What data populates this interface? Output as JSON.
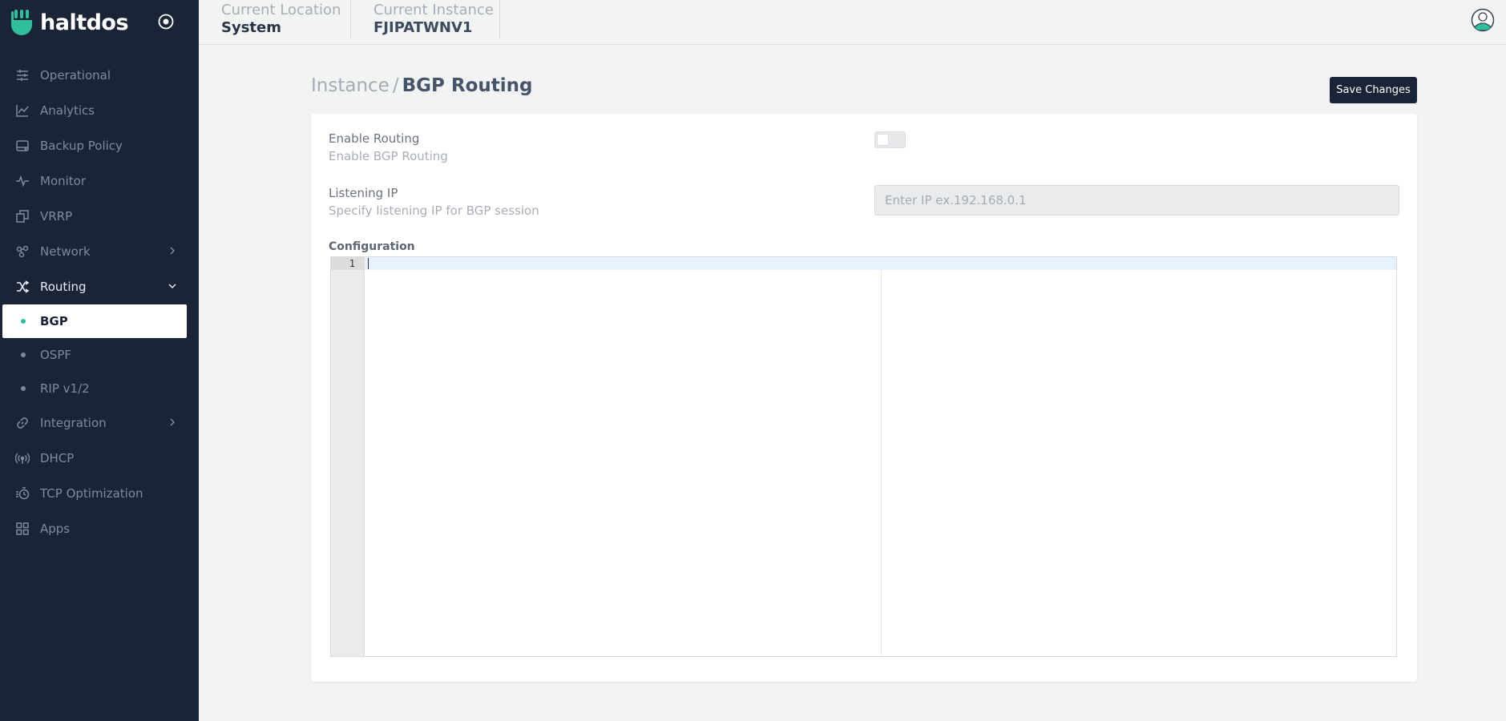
{
  "brand": {
    "name": "haltdos",
    "accent": "#2fbf9d"
  },
  "sidebar": {
    "items": [
      {
        "label": "Operational",
        "icon": "sliders-icon"
      },
      {
        "label": "Analytics",
        "icon": "chart-line-icon"
      },
      {
        "label": "Backup Policy",
        "icon": "hard-drive-icon"
      },
      {
        "label": "Monitor",
        "icon": "pulse-icon"
      },
      {
        "label": "VRRP",
        "icon": "copy-icon"
      },
      {
        "label": "Network",
        "icon": "network-icon"
      },
      {
        "label": "Routing",
        "icon": "shuffle-icon"
      },
      {
        "label": "Integration",
        "icon": "link-icon"
      },
      {
        "label": "DHCP",
        "icon": "broadcast-icon"
      },
      {
        "label": "TCP Optimization",
        "icon": "timer-icon"
      },
      {
        "label": "Apps",
        "icon": "grid-icon"
      }
    ],
    "routing_sub": [
      {
        "label": "BGP",
        "active": true
      },
      {
        "label": "OSPF",
        "active": false
      },
      {
        "label": "RIP v1/2",
        "active": false
      }
    ]
  },
  "header": {
    "location_label": "Current Location",
    "location_value": "System",
    "instance_label": "Current Instance",
    "instance_value": "FJIPATWNV1"
  },
  "page": {
    "breadcrumb_parent": "Instance",
    "breadcrumb_separator": "/",
    "breadcrumb_current": "BGP Routing",
    "save_label": "Save Changes"
  },
  "form": {
    "enable_label": "Enable Routing",
    "enable_help": "Enable BGP Routing",
    "enable_on": false,
    "ip_label": "Listening IP",
    "ip_help": "Specify listening IP for BGP session",
    "ip_placeholder": "Enter IP ex.192.168.0.1",
    "ip_value": "",
    "config_label": "Configuration",
    "editor_line": "1"
  }
}
